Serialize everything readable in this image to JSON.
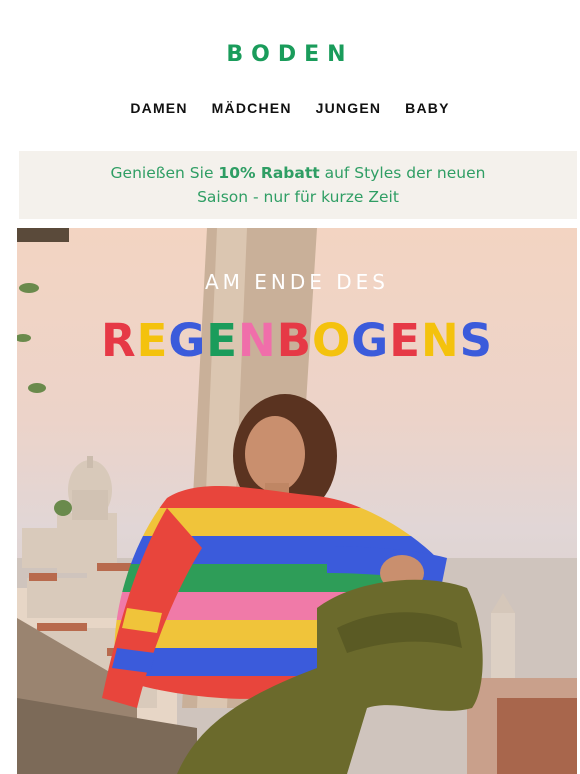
{
  "brand": {
    "logo": "BODEN",
    "color": "#1a9c5b"
  },
  "nav": {
    "items": [
      "DAMEN",
      "MÄDCHEN",
      "JUNGEN",
      "BABY"
    ]
  },
  "promo": {
    "prefix": "Genießen Sie ",
    "highlight": "10% Rabatt",
    "suffix": " auf Styles der neuen",
    "line2": "Saison - nur für kurze Zeit"
  },
  "hero": {
    "kicker": "AM ENDE DES",
    "headline": [
      {
        "char": "R",
        "color": "#e63946"
      },
      {
        "char": "E",
        "color": "#f4c20d"
      },
      {
        "char": "G",
        "color": "#3b5bdb"
      },
      {
        "char": "E",
        "color": "#1a9c5b"
      },
      {
        "char": "N",
        "color": "#f06eaa"
      },
      {
        "char": "B",
        "color": "#e63946"
      },
      {
        "char": "O",
        "color": "#f4c20d"
      },
      {
        "char": "G",
        "color": "#3b5bdb"
      },
      {
        "char": "E",
        "color": "#e63946"
      },
      {
        "char": "N",
        "color": "#f4c20d"
      },
      {
        "char": "S",
        "color": "#3b5bdb"
      }
    ]
  }
}
